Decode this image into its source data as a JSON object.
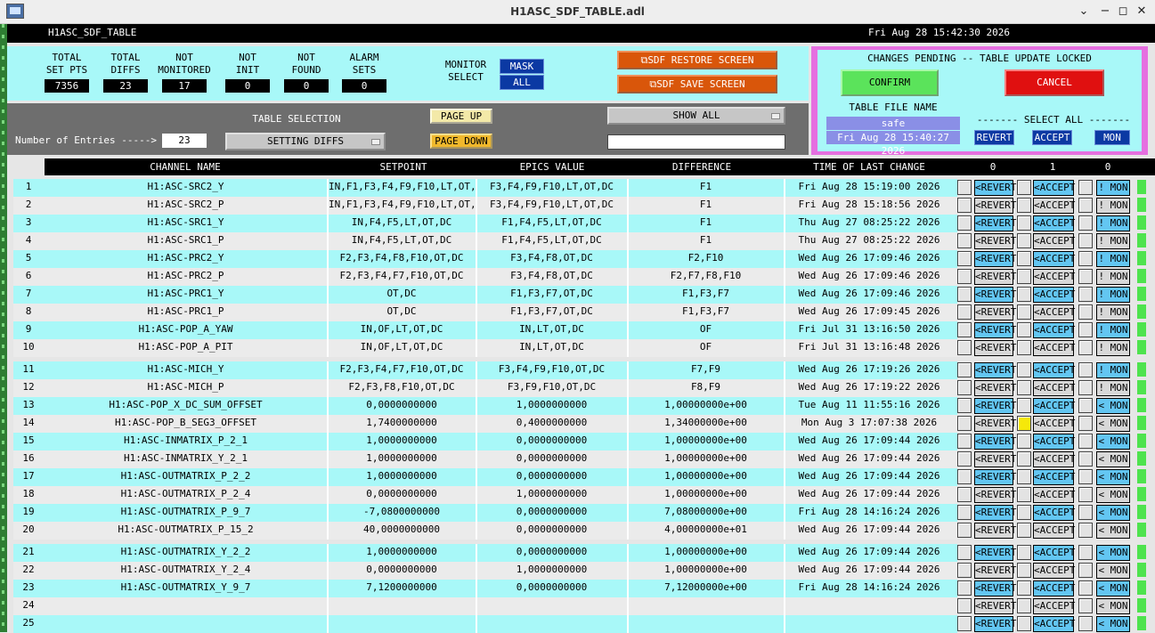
{
  "window": {
    "title": "H1ASC_SDF_TABLE.adl"
  },
  "header": {
    "screen_name": "H1ASC_SDF_TABLE",
    "datetime": "Fri Aug 28 15:42:30 2026"
  },
  "stats": [
    {
      "label_1": "TOTAL",
      "label_2": "SET PTS",
      "value": "7356"
    },
    {
      "label_1": "TOTAL",
      "label_2": "DIFFS",
      "value": "23"
    },
    {
      "label_1": "NOT",
      "label_2": "MONITORED",
      "value": "17"
    },
    {
      "label_1": "NOT",
      "label_2": "INIT",
      "value": "0"
    },
    {
      "label_1": "NOT",
      "label_2": "FOUND",
      "value": "0"
    },
    {
      "label_1": "ALARM",
      "label_2": "SETS",
      "value": "0"
    }
  ],
  "monitor": {
    "label_1": "MONITOR",
    "label_2": "SELECT",
    "mask": "MASK",
    "all": "ALL"
  },
  "buttons": {
    "restore": "SDF RESTORE SCREEN",
    "save": "SDF SAVE SCREEN",
    "page_up": "PAGE UP",
    "page_down": "PAGE DOWN",
    "show_all": "SHOW ALL"
  },
  "table_selection": {
    "title": "TABLE SELECTION",
    "entries_label": "Number of Entries ----->",
    "entries_value": "23",
    "selection": "SETTING DIFFS",
    "filter_value": ""
  },
  "pending": {
    "title": "CHANGES PENDING -- TABLE UPDATE LOCKED",
    "confirm": "CONFIRM",
    "cancel": "CANCEL",
    "file_label": "TABLE FILE NAME",
    "file_name": "safe",
    "file_time": "Fri Aug 28 15:40:27 2026",
    "select_all": "------- SELECT ALL -------",
    "revert": "REVERT",
    "accept": "ACCEPT",
    "mon": "MON"
  },
  "columns": {
    "channel": "CHANNEL NAME",
    "setpoint": "SETPOINT",
    "epics": "EPICS VALUE",
    "difference": "DIFFERENCE",
    "time": "TIME OF LAST CHANGE",
    "count_revert": "0",
    "count_accept": "1",
    "count_mon": "0"
  },
  "rows": [
    {
      "num": "1",
      "channel": "H1:ASC-SRC2_Y",
      "setpoint": "IN,F1,F3,F4,F9,F10,LT,OT,DC",
      "epics": "F3,F4,F9,F10,LT,OT,DC",
      "diff": "F1",
      "time": "Fri Aug 28 15:19:00 2026",
      "revert": "<REVERT",
      "accept": "<ACCEPT",
      "mon": "! MON",
      "hl": false
    },
    {
      "num": "2",
      "channel": "H1:ASC-SRC2_P",
      "setpoint": "IN,F1,F3,F4,F9,F10,LT,OT,DC",
      "epics": "F3,F4,F9,F10,LT,OT,DC",
      "diff": "F1",
      "time": "Fri Aug 28 15:18:56 2026",
      "revert": "<REVERT",
      "accept": "<ACCEPT",
      "mon": "! MON",
      "hl": false
    },
    {
      "num": "3",
      "channel": "H1:ASC-SRC1_Y",
      "setpoint": "IN,F4,F5,LT,OT,DC",
      "epics": "F1,F4,F5,LT,OT,DC",
      "diff": "F1",
      "time": "Thu Aug 27 08:25:22 2026",
      "revert": "<REVERT",
      "accept": "<ACCEPT",
      "mon": "! MON",
      "hl": false
    },
    {
      "num": "4",
      "channel": "H1:ASC-SRC1_P",
      "setpoint": "IN,F4,F5,LT,OT,DC",
      "epics": "F1,F4,F5,LT,OT,DC",
      "diff": "F1",
      "time": "Thu Aug 27 08:25:22 2026",
      "revert": "<REVERT",
      "accept": "<ACCEPT",
      "mon": "! MON",
      "hl": false
    },
    {
      "num": "5",
      "channel": "H1:ASC-PRC2_Y",
      "setpoint": "F2,F3,F4,F8,F10,OT,DC",
      "epics": "F3,F4,F8,OT,DC",
      "diff": "F2,F10",
      "time": "Wed Aug 26 17:09:46 2026",
      "revert": "<REVERT",
      "accept": "<ACCEPT",
      "mon": "! MON",
      "hl": false
    },
    {
      "num": "6",
      "channel": "H1:ASC-PRC2_P",
      "setpoint": "F2,F3,F4,F7,F10,OT,DC",
      "epics": "F3,F4,F8,OT,DC",
      "diff": "F2,F7,F8,F10",
      "time": "Wed Aug 26 17:09:46 2026",
      "revert": "<REVERT",
      "accept": "<ACCEPT",
      "mon": "! MON",
      "hl": false
    },
    {
      "num": "7",
      "channel": "H1:ASC-PRC1_Y",
      "setpoint": "OT,DC",
      "epics": "F1,F3,F7,OT,DC",
      "diff": "F1,F3,F7",
      "time": "Wed Aug 26 17:09:46 2026",
      "revert": "<REVERT",
      "accept": "<ACCEPT",
      "mon": "! MON",
      "hl": false
    },
    {
      "num": "8",
      "channel": "H1:ASC-PRC1_P",
      "setpoint": "OT,DC",
      "epics": "F1,F3,F7,OT,DC",
      "diff": "F1,F3,F7",
      "time": "Wed Aug 26 17:09:45 2026",
      "revert": "<REVERT",
      "accept": "<ACCEPT",
      "mon": "! MON",
      "hl": false
    },
    {
      "num": "9",
      "channel": "H1:ASC-POP_A_YAW",
      "setpoint": "IN,OF,LT,OT,DC",
      "epics": "IN,LT,OT,DC",
      "diff": "OF",
      "time": "Fri Jul 31 13:16:50 2026",
      "revert": "<REVERT",
      "accept": "<ACCEPT",
      "mon": "! MON",
      "hl": false
    },
    {
      "num": "10",
      "channel": "H1:ASC-POP_A_PIT",
      "setpoint": "IN,OF,LT,OT,DC",
      "epics": "IN,LT,OT,DC",
      "diff": "OF",
      "time": "Fri Jul 31 13:16:48 2026",
      "revert": "<REVERT",
      "accept": "<ACCEPT",
      "mon": "! MON",
      "hl": false
    },
    {
      "num": "11",
      "channel": "H1:ASC-MICH_Y",
      "setpoint": "F2,F3,F4,F7,F10,OT,DC",
      "epics": "F3,F4,F9,F10,OT,DC",
      "diff": "F7,F9",
      "time": "Wed Aug 26 17:19:26 2026",
      "revert": "<REVERT",
      "accept": "<ACCEPT",
      "mon": "! MON",
      "hl": false
    },
    {
      "num": "12",
      "channel": "H1:ASC-MICH_P",
      "setpoint": "F2,F3,F8,F10,OT,DC",
      "epics": "F3,F9,F10,OT,DC",
      "diff": "F8,F9",
      "time": "Wed Aug 26 17:19:22 2026",
      "revert": "<REVERT",
      "accept": "<ACCEPT",
      "mon": "! MON",
      "hl": false
    },
    {
      "num": "13",
      "channel": "H1:ASC-POP_X_DC_SUM_OFFSET",
      "setpoint": "0,0000000000",
      "epics": "1,0000000000",
      "diff": "1,00000000e+00",
      "time": "Tue Aug 11 11:55:16 2026",
      "revert": "<REVERT",
      "accept": "<ACCEPT",
      "mon": "< MON",
      "hl": false
    },
    {
      "num": "14",
      "channel": "H1:ASC-POP_B_SEG3_OFFSET",
      "setpoint": "1,7400000000",
      "epics": "0,4000000000",
      "diff": "1,34000000e+00",
      "time": "Mon Aug  3 17:07:38 2026",
      "revert": "<REVERT",
      "accept": "<ACCEPT",
      "mon": "< MON",
      "hl": true
    },
    {
      "num": "15",
      "channel": "H1:ASC-INMATRIX_P_2_1",
      "setpoint": "1,0000000000",
      "epics": "0,0000000000",
      "diff": "1,00000000e+00",
      "time": "Wed Aug 26 17:09:44 2026",
      "revert": "<REVERT",
      "accept": "<ACCEPT",
      "mon": "< MON",
      "hl": false
    },
    {
      "num": "16",
      "channel": "H1:ASC-INMATRIX_Y_2_1",
      "setpoint": "1,0000000000",
      "epics": "0,0000000000",
      "diff": "1,00000000e+00",
      "time": "Wed Aug 26 17:09:44 2026",
      "revert": "<REVERT",
      "accept": "<ACCEPT",
      "mon": "< MON",
      "hl": false
    },
    {
      "num": "17",
      "channel": "H1:ASC-OUTMATRIX_P_2_2",
      "setpoint": "1,0000000000",
      "epics": "0,0000000000",
      "diff": "1,00000000e+00",
      "time": "Wed Aug 26 17:09:44 2026",
      "revert": "<REVERT",
      "accept": "<ACCEPT",
      "mon": "< MON",
      "hl": false
    },
    {
      "num": "18",
      "channel": "H1:ASC-OUTMATRIX_P_2_4",
      "setpoint": "0,0000000000",
      "epics": "1,0000000000",
      "diff": "1,00000000e+00",
      "time": "Wed Aug 26 17:09:44 2026",
      "revert": "<REVERT",
      "accept": "<ACCEPT",
      "mon": "< MON",
      "hl": false
    },
    {
      "num": "19",
      "channel": "H1:ASC-OUTMATRIX_P_9_7",
      "setpoint": "-7,0800000000",
      "epics": "0,0000000000",
      "diff": "7,08000000e+00",
      "time": "Fri Aug 28 14:16:24 2026",
      "revert": "<REVERT",
      "accept": "<ACCEPT",
      "mon": "< MON",
      "hl": false
    },
    {
      "num": "20",
      "channel": "H1:ASC-OUTMATRIX_P_15_2",
      "setpoint": "40,0000000000",
      "epics": "0,0000000000",
      "diff": "4,00000000e+01",
      "time": "Wed Aug 26 17:09:44 2026",
      "revert": "<REVERT",
      "accept": "<ACCEPT",
      "mon": "< MON",
      "hl": false
    },
    {
      "num": "21",
      "channel": "H1:ASC-OUTMATRIX_Y_2_2",
      "setpoint": "1,0000000000",
      "epics": "0,0000000000",
      "diff": "1,00000000e+00",
      "time": "Wed Aug 26 17:09:44 2026",
      "revert": "<REVERT",
      "accept": "<ACCEPT",
      "mon": "< MON",
      "hl": false
    },
    {
      "num": "22",
      "channel": "H1:ASC-OUTMATRIX_Y_2_4",
      "setpoint": "0,0000000000",
      "epics": "1,0000000000",
      "diff": "1,00000000e+00",
      "time": "Wed Aug 26 17:09:44 2026",
      "revert": "<REVERT",
      "accept": "<ACCEPT",
      "mon": "< MON",
      "hl": false
    },
    {
      "num": "23",
      "channel": "H1:ASC-OUTMATRIX_Y_9_7",
      "setpoint": "7,1200000000",
      "epics": "0,0000000000",
      "diff": "7,12000000e+00",
      "time": "Fri Aug 28 14:16:24 2026",
      "revert": "<REVERT",
      "accept": "<ACCEPT",
      "mon": "< MON",
      "hl": false
    },
    {
      "num": "24",
      "channel": "",
      "setpoint": "",
      "epics": "",
      "diff": "",
      "time": "",
      "revert": "<REVERT",
      "accept": "<ACCEPT",
      "mon": "< MON",
      "hl": false
    },
    {
      "num": "25",
      "channel": "",
      "setpoint": "",
      "epics": "",
      "diff": "",
      "time": "",
      "revert": "<REVERT",
      "accept": "<ACCEPT",
      "mon": "< MON",
      "hl": false
    }
  ],
  "colors": {
    "cyan": "#a8f8f8",
    "row_alt": "#ebebeb",
    "ctl_blue": "#63c6f2",
    "ctl_gray": "#d8d8d8",
    "ind_green": "#4ee34e",
    "hl_yellow": "#f6e80a"
  }
}
